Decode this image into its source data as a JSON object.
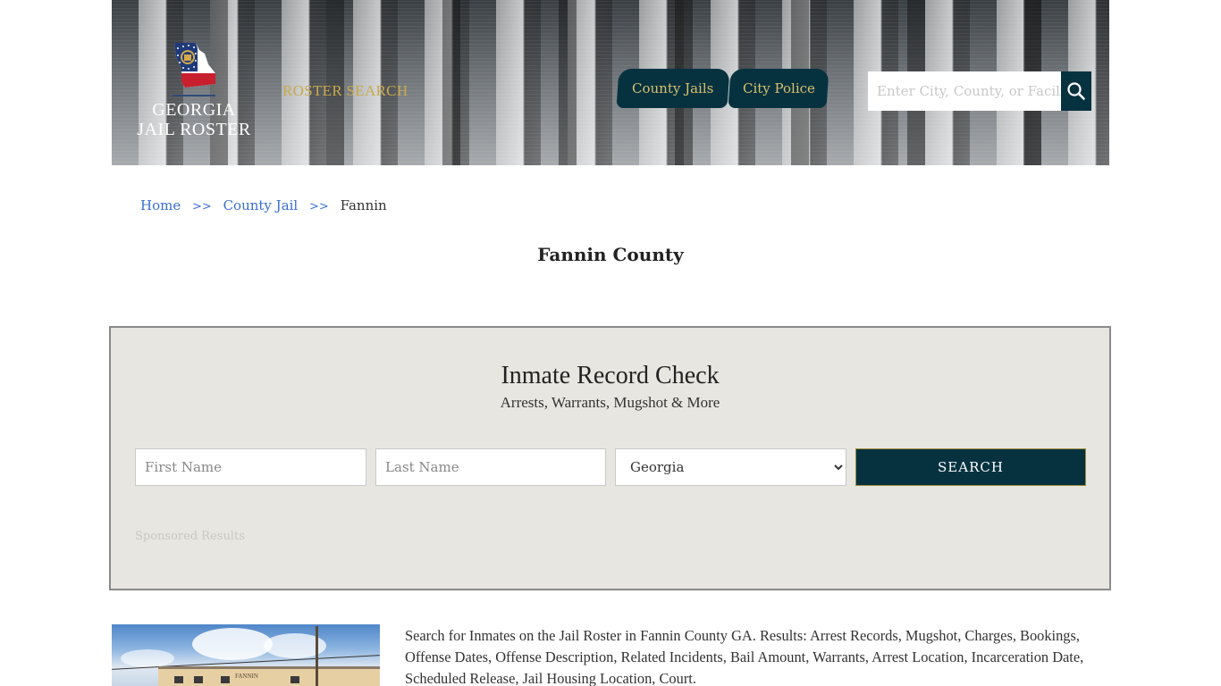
{
  "header": {
    "logo": {
      "line1": "GEORGIA",
      "line2": "JAIL ROSTER",
      "icon": "georgia-state-flag-map-icon"
    },
    "tagline": "ROSTER SEARCH",
    "nav": [
      {
        "label": "County Jails"
      },
      {
        "label": "City Police"
      }
    ],
    "search": {
      "placeholder": "Enter City, County, or Facility",
      "value": "",
      "icon": "search-icon"
    }
  },
  "breadcrumb": {
    "items": [
      {
        "label": "Home"
      },
      {
        "label": "County Jail"
      }
    ],
    "separator": ">>",
    "current": "Fannin"
  },
  "page_title": "Fannin County",
  "record_check": {
    "title": "Inmate Record Check",
    "subtitle": "Arrests, Warrants, Mugshot & More",
    "first_name": {
      "placeholder": "First Name",
      "value": ""
    },
    "last_name": {
      "placeholder": "Last Name",
      "value": ""
    },
    "state": {
      "selected": "Georgia"
    },
    "submit_label": "SEARCH",
    "sponsored_label": "Sponsored Results"
  },
  "content": {
    "photo_sign": "FANNIN",
    "description": "Search for Inmates on the Jail Roster in Fannin County GA. Results: Arrest Records, Mugshot, Charges, Bookings, Offense Dates, Offense Description, Related Incidents, Bail Amount, Warrants, Arrest Location, Incarceration Date, Scheduled Release, Jail Housing Location, Court."
  },
  "colors": {
    "brand_dark": "#063240",
    "gold": "#c9a94a",
    "link": "#3a6fd0",
    "panel_bg": "#e8e6e1"
  }
}
